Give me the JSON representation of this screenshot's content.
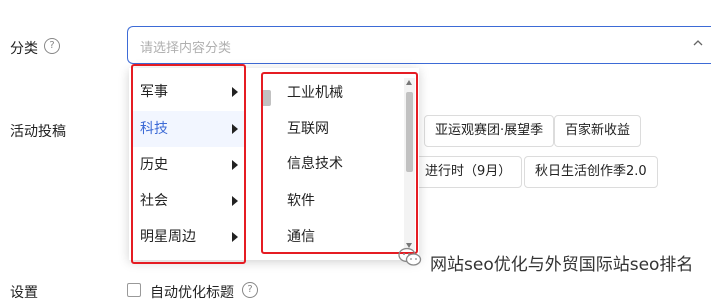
{
  "form": {
    "category_label": "分类",
    "help_symbol": "?",
    "category_placeholder": "请选择内容分类",
    "activity_label": "活动投稿",
    "settings_label": "设置",
    "auto_optimize_label": "自动优化标题"
  },
  "cascader": {
    "level1": [
      {
        "label": "军事",
        "active": false
      },
      {
        "label": "科技",
        "active": true
      },
      {
        "label": "历史",
        "active": false
      },
      {
        "label": "社会",
        "active": false
      },
      {
        "label": "明星周边",
        "active": false
      }
    ],
    "level2": [
      "工业机械",
      "互联网",
      "信息技术",
      "软件",
      "通信"
    ]
  },
  "activity_tags": [
    "亚运观赛团·展望季",
    "百家新收益",
    "进行时（9月）",
    "秋日生活创作季2.0"
  ],
  "watermark": {
    "text": "网站seo优化与外贸国际站seo排名",
    "icon": "wechat-icon"
  },
  "colors": {
    "accent": "#3d6bd6",
    "highlight_frame": "#e51c23"
  }
}
